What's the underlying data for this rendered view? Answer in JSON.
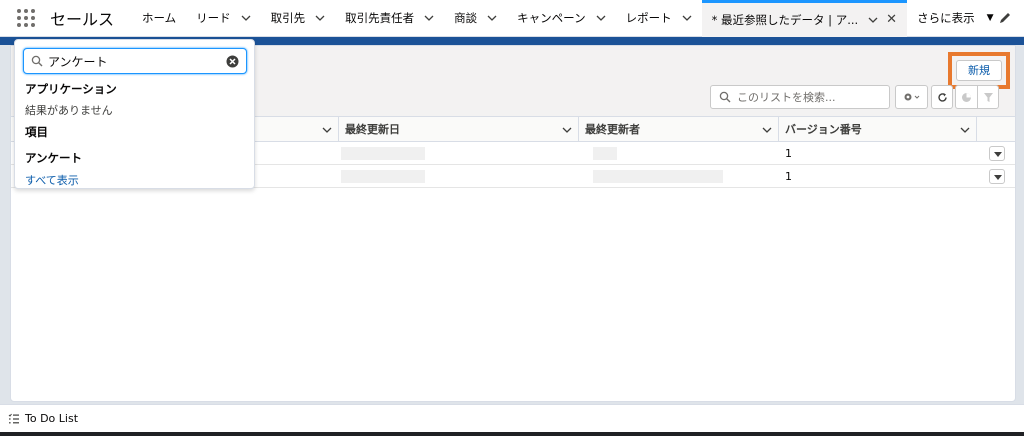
{
  "app": {
    "name": "セールス"
  },
  "nav": {
    "tabs": [
      {
        "label": "ホーム"
      },
      {
        "label": "リード"
      },
      {
        "label": "取引先"
      },
      {
        "label": "取引先責任者"
      },
      {
        "label": "商談"
      },
      {
        "label": "キャンペーン"
      },
      {
        "label": "レポート"
      }
    ],
    "active_tab": {
      "label": "* 最近参照したデータ | ア..."
    },
    "more_label": "さらに表示"
  },
  "header": {
    "new_button_label": "新規"
  },
  "list_search": {
    "placeholder": "このリストを検索..."
  },
  "table": {
    "columns": [
      "最終更新日",
      "最終更新者",
      "バージョン番号"
    ],
    "rows": [
      {
        "version": "1"
      },
      {
        "version": "1"
      }
    ]
  },
  "search_panel": {
    "query": "アンケート",
    "applications_heading": "アプリケーション",
    "no_results": "結果がありません",
    "items_heading": "項目",
    "item_result": "アンケート",
    "show_all": "すべて表示"
  },
  "footer": {
    "todo_label": "To Do List"
  },
  "colors": {
    "accent": "#1b96ff",
    "brand_band": "#1b5297",
    "highlight": "#e8792e",
    "link": "#0b5cab"
  }
}
